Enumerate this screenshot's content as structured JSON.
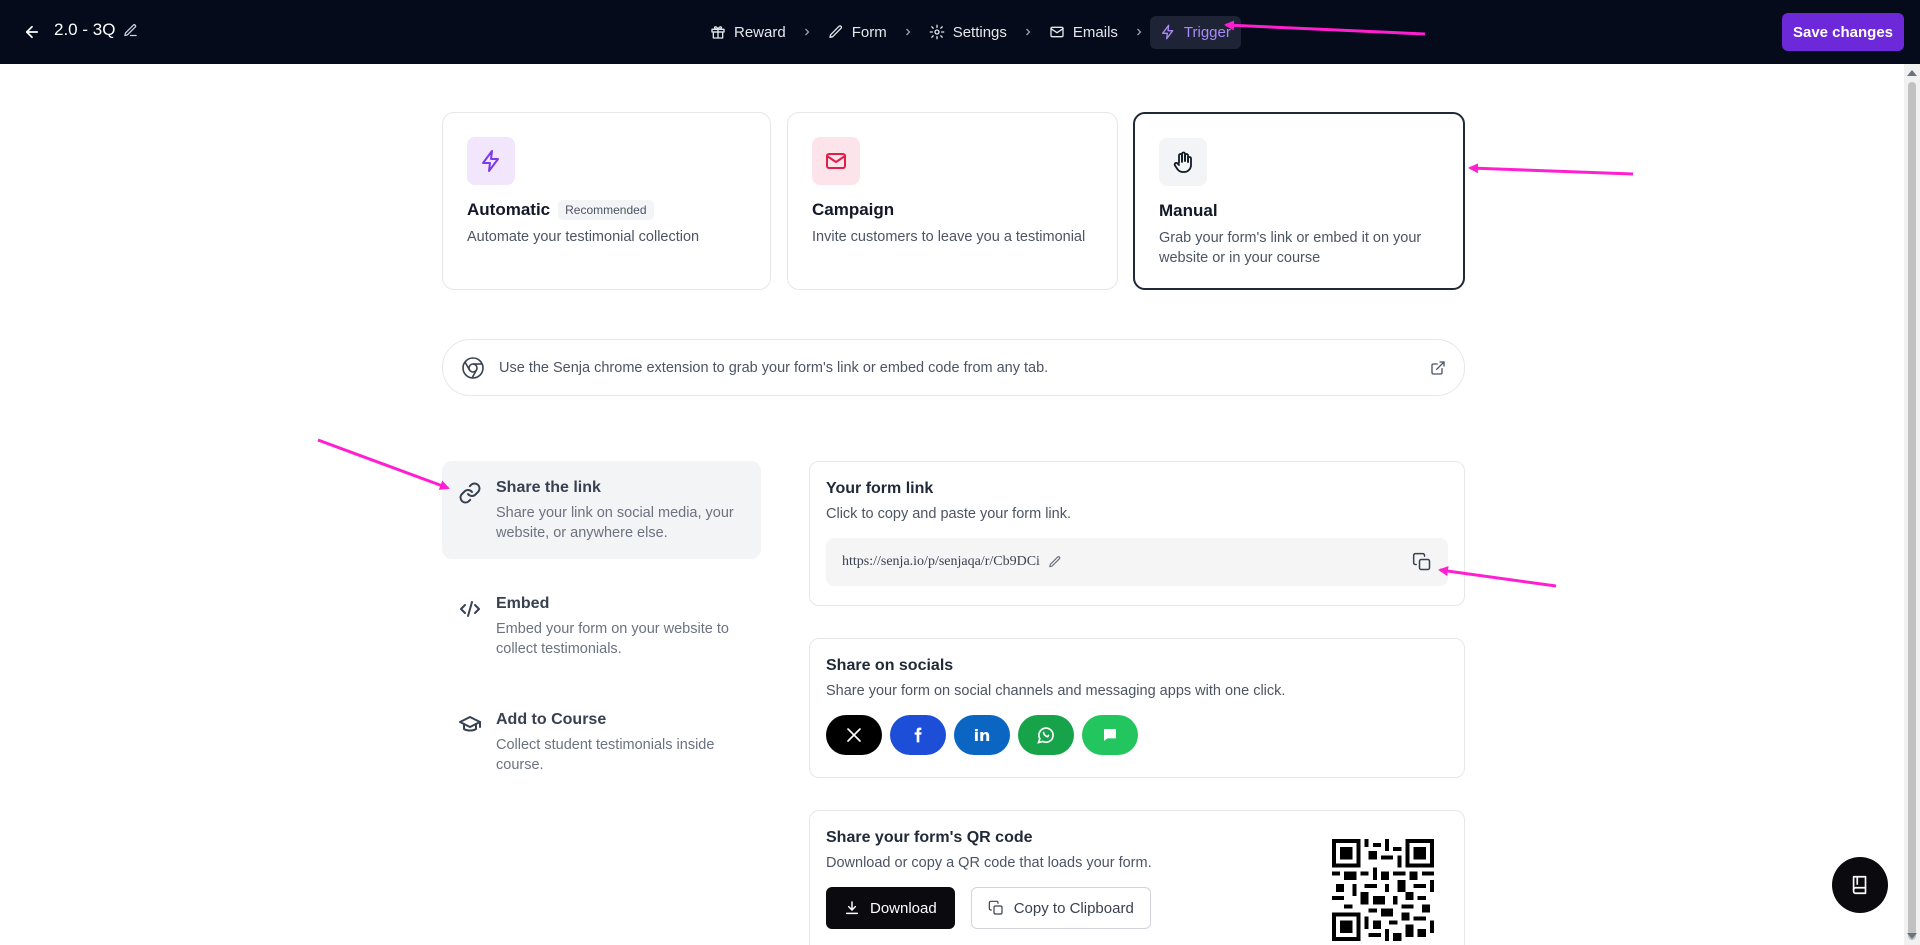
{
  "header": {
    "form_title": "2.0 - 3Q",
    "steps": [
      {
        "label": "Reward",
        "icon": "gift-icon"
      },
      {
        "label": "Form",
        "icon": "pencil-icon"
      },
      {
        "label": "Settings",
        "icon": "gear-icon"
      },
      {
        "label": "Emails",
        "icon": "mail-icon"
      },
      {
        "label": "Trigger",
        "icon": "bolt-icon",
        "active": true
      }
    ],
    "save_label": "Save changes"
  },
  "trigger_cards": [
    {
      "title": "Automatic",
      "badge": "Recommended",
      "desc": "Automate your testimonial collection",
      "icon": "bolt-icon",
      "color": "#7c3aed"
    },
    {
      "title": "Campaign",
      "desc": "Invite customers to leave you a testimonial",
      "icon": "mail-icon",
      "color": "#e11d48"
    },
    {
      "title": "Manual",
      "desc": "Grab your form's link or embed it on your website or in your course",
      "icon": "hand-icon",
      "selected": true
    }
  ],
  "extension": {
    "text": "Use the Senja chrome extension to grab your form's link or embed code from any tab."
  },
  "options": [
    {
      "title": "Share the link",
      "desc": "Share your link on social media, your website, or anywhere else.",
      "active": true
    },
    {
      "title": "Embed",
      "desc": "Embed your form on your website to collect testimonials."
    },
    {
      "title": "Add to Course",
      "desc": "Collect student testimonials inside course."
    }
  ],
  "form_link": {
    "title": "Your form link",
    "desc": "Click to copy and paste your form link.",
    "url": "https://senja.io/p/senjaqa/r/Cb9DCi"
  },
  "socials": {
    "title": "Share on socials",
    "desc": "Share your form on social channels and messaging apps with one click.",
    "items": [
      {
        "name": "x",
        "color": "#000000"
      },
      {
        "name": "facebook",
        "color": "#1d4ed8"
      },
      {
        "name": "linkedin",
        "color": "#0a66c2"
      },
      {
        "name": "whatsapp",
        "color": "#16a34a"
      },
      {
        "name": "message",
        "color": "#22c55e"
      }
    ]
  },
  "qr": {
    "title": "Share your form's QR code",
    "desc": "Download or copy a QR code that loads your form.",
    "download_label": "Download",
    "copy_label": "Copy to Clipboard"
  }
}
